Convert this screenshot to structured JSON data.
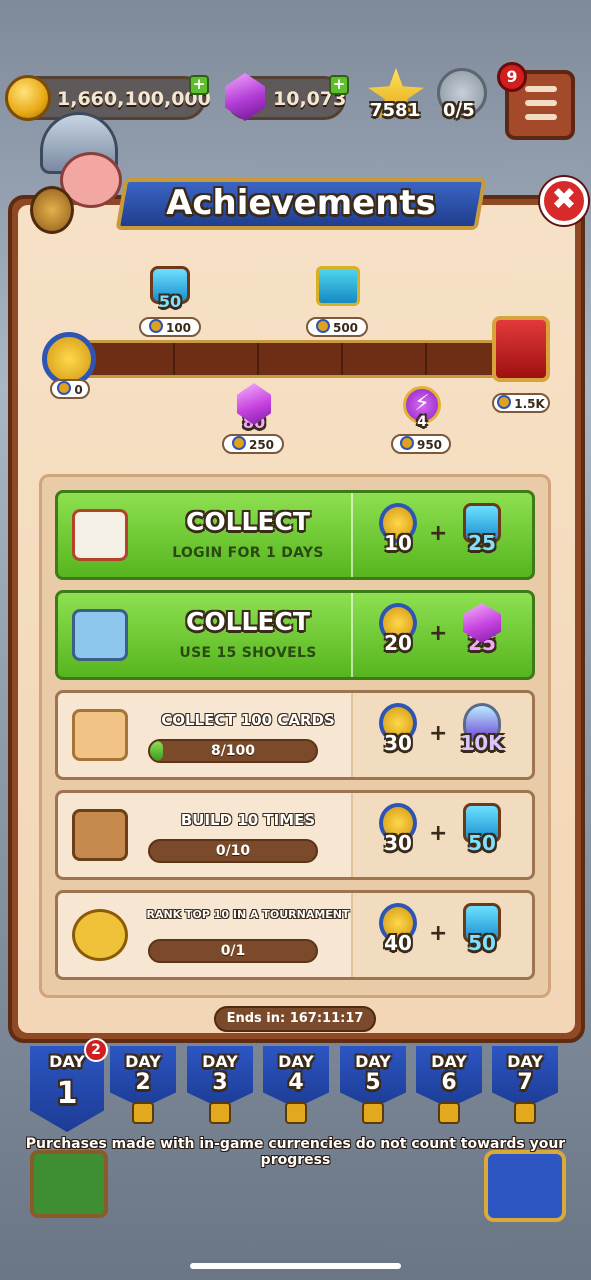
{
  "topbar": {
    "coins": "1,660,100,000",
    "gems": "10,073",
    "stars": "7581",
    "shields": "0/5",
    "menu_badge": "9",
    "plus": "+"
  },
  "panel": {
    "title": "Achievements",
    "close": "✖"
  },
  "track": {
    "start": "0",
    "milestones": [
      {
        "points": "100",
        "reward": "50"
      },
      {
        "points": "250",
        "reward": "80"
      },
      {
        "points": "500",
        "reward": ""
      },
      {
        "points": "950",
        "reward": "4"
      },
      {
        "points": "1.5K",
        "reward": ""
      }
    ]
  },
  "tasks": [
    {
      "state": "collect",
      "title": "COLLECT",
      "subtitle": "LOGIN FOR 1 DAYS",
      "points": "10",
      "plus": "+",
      "reward": "25"
    },
    {
      "state": "collect",
      "title": "COLLECT",
      "subtitle": "USE 15 SHOVELS",
      "points": "20",
      "plus": "+",
      "reward": "25"
    },
    {
      "state": "progress",
      "title": "COLLECT 100 CARDS",
      "progress_text": "8/100",
      "progress_frac": 0.08,
      "points": "30",
      "plus": "+",
      "reward": "10K"
    },
    {
      "state": "progress",
      "title": "BUILD 10 TIMES",
      "progress_text": "0/10",
      "progress_frac": 0,
      "points": "30",
      "plus": "+",
      "reward": "50"
    },
    {
      "state": "progress",
      "title": "RANK TOP 10 IN A TOURNAMENT",
      "progress_text": "0/1",
      "progress_frac": 0,
      "points": "40",
      "plus": "+",
      "reward": "50"
    }
  ],
  "ends_in": "Ends in: 167:11:17",
  "days": {
    "label": "DAY",
    "active_badge": "2",
    "numbers": [
      "1",
      "2",
      "3",
      "4",
      "5",
      "6",
      "7"
    ]
  },
  "footnote": "Purchases made with in-game currencies do not count towards your progress",
  "colors": {
    "accent_green": "#56b51f",
    "banner_blue": "#1f3e8e",
    "panel_brown": "#8f4a25"
  }
}
